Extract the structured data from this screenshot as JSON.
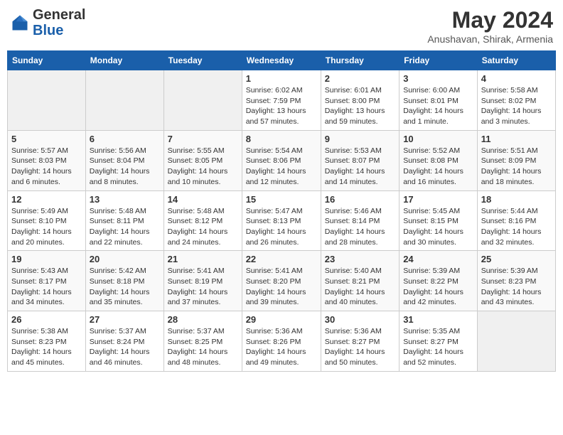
{
  "header": {
    "logo_general": "General",
    "logo_blue": "Blue",
    "month_title": "May 2024",
    "location": "Anushavan, Shirak, Armenia"
  },
  "weekdays": [
    "Sunday",
    "Monday",
    "Tuesday",
    "Wednesday",
    "Thursday",
    "Friday",
    "Saturday"
  ],
  "weeks": [
    [
      {
        "day": "",
        "info": ""
      },
      {
        "day": "",
        "info": ""
      },
      {
        "day": "",
        "info": ""
      },
      {
        "day": "1",
        "info": "Sunrise: 6:02 AM\nSunset: 7:59 PM\nDaylight: 13 hours\nand 57 minutes."
      },
      {
        "day": "2",
        "info": "Sunrise: 6:01 AM\nSunset: 8:00 PM\nDaylight: 13 hours\nand 59 minutes."
      },
      {
        "day": "3",
        "info": "Sunrise: 6:00 AM\nSunset: 8:01 PM\nDaylight: 14 hours\nand 1 minute."
      },
      {
        "day": "4",
        "info": "Sunrise: 5:58 AM\nSunset: 8:02 PM\nDaylight: 14 hours\nand 3 minutes."
      }
    ],
    [
      {
        "day": "5",
        "info": "Sunrise: 5:57 AM\nSunset: 8:03 PM\nDaylight: 14 hours\nand 6 minutes."
      },
      {
        "day": "6",
        "info": "Sunrise: 5:56 AM\nSunset: 8:04 PM\nDaylight: 14 hours\nand 8 minutes."
      },
      {
        "day": "7",
        "info": "Sunrise: 5:55 AM\nSunset: 8:05 PM\nDaylight: 14 hours\nand 10 minutes."
      },
      {
        "day": "8",
        "info": "Sunrise: 5:54 AM\nSunset: 8:06 PM\nDaylight: 14 hours\nand 12 minutes."
      },
      {
        "day": "9",
        "info": "Sunrise: 5:53 AM\nSunset: 8:07 PM\nDaylight: 14 hours\nand 14 minutes."
      },
      {
        "day": "10",
        "info": "Sunrise: 5:52 AM\nSunset: 8:08 PM\nDaylight: 14 hours\nand 16 minutes."
      },
      {
        "day": "11",
        "info": "Sunrise: 5:51 AM\nSunset: 8:09 PM\nDaylight: 14 hours\nand 18 minutes."
      }
    ],
    [
      {
        "day": "12",
        "info": "Sunrise: 5:49 AM\nSunset: 8:10 PM\nDaylight: 14 hours\nand 20 minutes."
      },
      {
        "day": "13",
        "info": "Sunrise: 5:48 AM\nSunset: 8:11 PM\nDaylight: 14 hours\nand 22 minutes."
      },
      {
        "day": "14",
        "info": "Sunrise: 5:48 AM\nSunset: 8:12 PM\nDaylight: 14 hours\nand 24 minutes."
      },
      {
        "day": "15",
        "info": "Sunrise: 5:47 AM\nSunset: 8:13 PM\nDaylight: 14 hours\nand 26 minutes."
      },
      {
        "day": "16",
        "info": "Sunrise: 5:46 AM\nSunset: 8:14 PM\nDaylight: 14 hours\nand 28 minutes."
      },
      {
        "day": "17",
        "info": "Sunrise: 5:45 AM\nSunset: 8:15 PM\nDaylight: 14 hours\nand 30 minutes."
      },
      {
        "day": "18",
        "info": "Sunrise: 5:44 AM\nSunset: 8:16 PM\nDaylight: 14 hours\nand 32 minutes."
      }
    ],
    [
      {
        "day": "19",
        "info": "Sunrise: 5:43 AM\nSunset: 8:17 PM\nDaylight: 14 hours\nand 34 minutes."
      },
      {
        "day": "20",
        "info": "Sunrise: 5:42 AM\nSunset: 8:18 PM\nDaylight: 14 hours\nand 35 minutes."
      },
      {
        "day": "21",
        "info": "Sunrise: 5:41 AM\nSunset: 8:19 PM\nDaylight: 14 hours\nand 37 minutes."
      },
      {
        "day": "22",
        "info": "Sunrise: 5:41 AM\nSunset: 8:20 PM\nDaylight: 14 hours\nand 39 minutes."
      },
      {
        "day": "23",
        "info": "Sunrise: 5:40 AM\nSunset: 8:21 PM\nDaylight: 14 hours\nand 40 minutes."
      },
      {
        "day": "24",
        "info": "Sunrise: 5:39 AM\nSunset: 8:22 PM\nDaylight: 14 hours\nand 42 minutes."
      },
      {
        "day": "25",
        "info": "Sunrise: 5:39 AM\nSunset: 8:23 PM\nDaylight: 14 hours\nand 43 minutes."
      }
    ],
    [
      {
        "day": "26",
        "info": "Sunrise: 5:38 AM\nSunset: 8:23 PM\nDaylight: 14 hours\nand 45 minutes."
      },
      {
        "day": "27",
        "info": "Sunrise: 5:37 AM\nSunset: 8:24 PM\nDaylight: 14 hours\nand 46 minutes."
      },
      {
        "day": "28",
        "info": "Sunrise: 5:37 AM\nSunset: 8:25 PM\nDaylight: 14 hours\nand 48 minutes."
      },
      {
        "day": "29",
        "info": "Sunrise: 5:36 AM\nSunset: 8:26 PM\nDaylight: 14 hours\nand 49 minutes."
      },
      {
        "day": "30",
        "info": "Sunrise: 5:36 AM\nSunset: 8:27 PM\nDaylight: 14 hours\nand 50 minutes."
      },
      {
        "day": "31",
        "info": "Sunrise: 5:35 AM\nSunset: 8:27 PM\nDaylight: 14 hours\nand 52 minutes."
      },
      {
        "day": "",
        "info": ""
      }
    ]
  ]
}
